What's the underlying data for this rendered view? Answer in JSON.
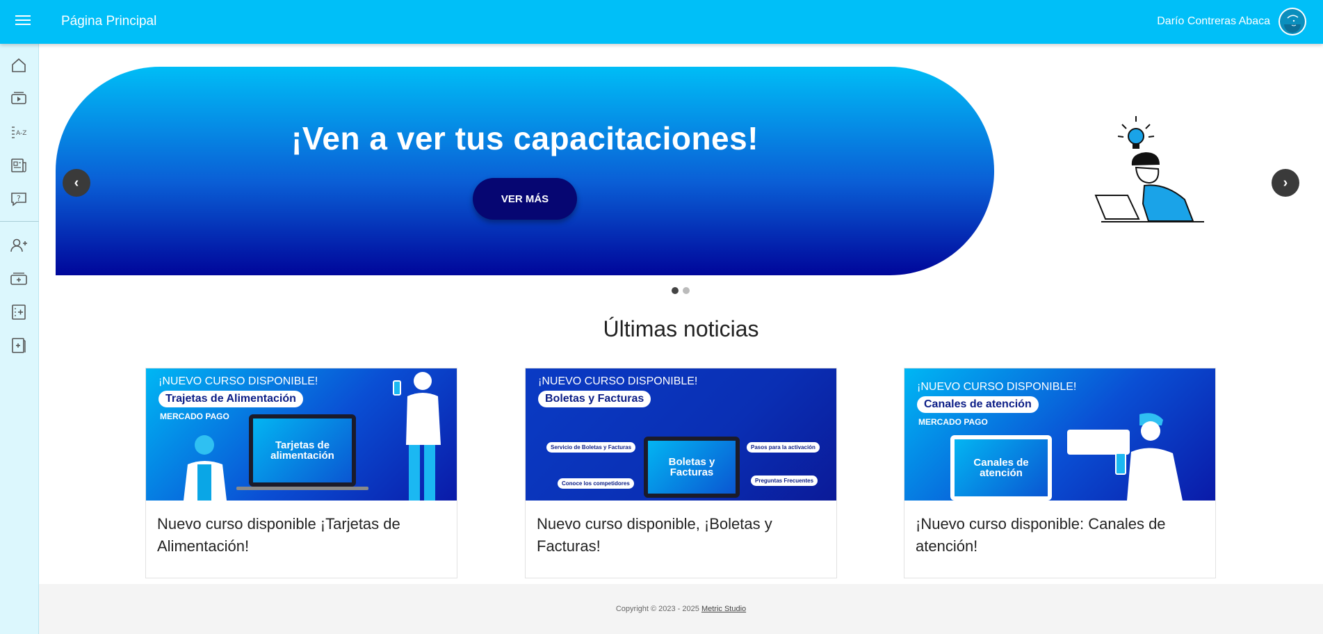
{
  "header": {
    "title": "Página Principal",
    "user_name": "Darío Contreras Abaca"
  },
  "sidebar": {
    "items": [
      {
        "icon": "home-icon"
      },
      {
        "icon": "video-icon"
      },
      {
        "icon": "glossary-icon"
      },
      {
        "icon": "news-icon"
      },
      {
        "icon": "help-icon"
      },
      {
        "icon": "add-user-icon"
      },
      {
        "icon": "add-course-icon"
      },
      {
        "icon": "add-list-icon"
      },
      {
        "icon": "add-document-icon"
      }
    ]
  },
  "banner": {
    "title": "¡Ven a ver tus capacitaciones!",
    "button_label": "VER MÁS",
    "arrow_prev": "‹",
    "arrow_next": "›",
    "slides_count": 2,
    "active_slide": 1
  },
  "news": {
    "section_title": "Últimas noticias",
    "cards": [
      {
        "caption": "Nuevo curso disponible ¡Tarjetas de Alimentación!",
        "thumb_header": "¡NUEVO CURSO DISPONIBLE!",
        "thumb_tag": "Trajetas de Alimentación",
        "thumb_sub": "MERCADO PAGO",
        "thumb_screen": "Tarjetas de alimentación"
      },
      {
        "caption": "Nuevo curso disponible, ¡Boletas y Facturas!",
        "thumb_header": "¡NUEVO CURSO DISPONIBLE!",
        "thumb_tag": "Boletas y Facturas",
        "thumb_screen": "Boletas y Facturas",
        "thumb_notes": [
          "Servicio de Boletas y Facturas",
          "Pasos para la activación",
          "Conoce los competidores",
          "Preguntas Frecuentes"
        ]
      },
      {
        "caption": "¡Nuevo curso disponible: Canales de atención!",
        "thumb_header": "¡NUEVO CURSO DISPONIBLE!",
        "thumb_tag": "Canales de atención",
        "thumb_sub": "MERCADO PAGO",
        "thumb_screen": "Canales de atención"
      }
    ]
  },
  "footer": {
    "copyright": "Copyright © 2023 - 2025",
    "link": "Metric Studio"
  },
  "colors": {
    "topbar": "#00bff8",
    "sidebar": "#dcf7fd",
    "button_dark": "#060672"
  }
}
